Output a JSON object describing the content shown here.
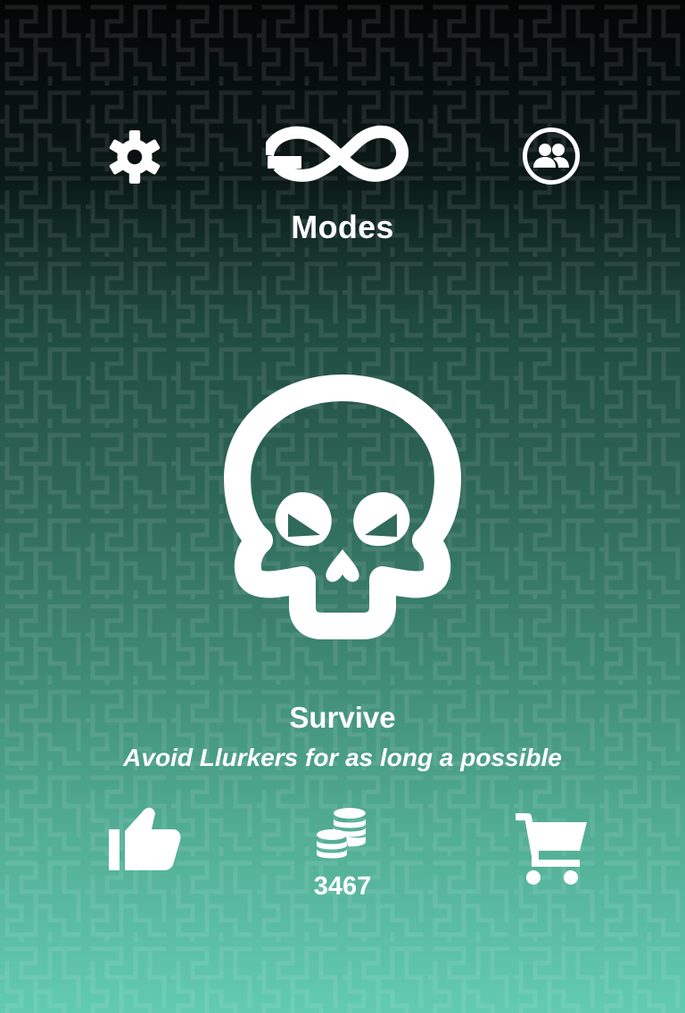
{
  "header": {
    "settings_icon": "gear-icon",
    "friends_icon": "friends-icon",
    "modes_icon": "infinity-icon",
    "modes_label": "Modes"
  },
  "mode": {
    "icon": "skull-icon",
    "title": "Survive",
    "description": "Avoid Llurkers for as long a possible"
  },
  "footer": {
    "like_icon": "thumbs-up-icon",
    "coins_icon": "coins-icon",
    "coins": "3467",
    "cart_icon": "cart-icon"
  },
  "colors": {
    "background_top": "#030505",
    "background_bottom": "#62cbb1",
    "foreground": "#ffffff"
  }
}
